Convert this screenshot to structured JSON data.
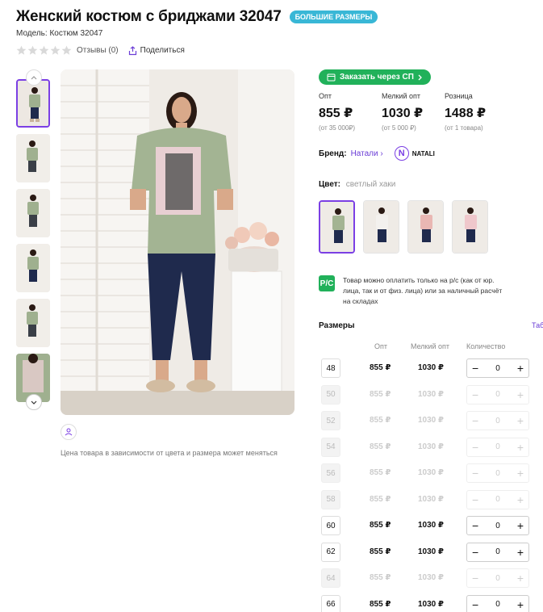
{
  "product": {
    "title": "Женский костюм с бриджами 32047",
    "badge": "БОЛЬШИЕ РАЗМЕРЫ",
    "model": "Модель: Костюм 32047",
    "reviews": "Отзывы (0)",
    "share": "Поделиться",
    "price_note": "Цена товара в зависимости от цвета и размера может меняться"
  },
  "order_sp": "Заказать через СП",
  "prices": [
    {
      "label": "Опт",
      "value": "855 ₽",
      "sub": "(от 35 000₽)"
    },
    {
      "label": "Мелкий опт",
      "value": "1030 ₽",
      "sub": "(от 5 000 ₽)"
    },
    {
      "label": "Розница",
      "value": "1488 ₽",
      "sub": "(от 1 товара)"
    }
  ],
  "brand": {
    "label": "Бренд:",
    "name": "Натали",
    "logo_text": "NATALI"
  },
  "color": {
    "label": "Цвет:",
    "value": "светлый хаки"
  },
  "payment": {
    "icon_text": "Р/С",
    "text": "Товар можно оплатить только на р/с (как от юр. лица, так и от физ. лица) или за наличный расчёт на складах"
  },
  "sizes": {
    "title": "Размеры",
    "table_link": "Таб",
    "headers": {
      "opt": "Опт",
      "small_opt": "Мелкий опт",
      "qty": "Количество"
    },
    "rows": [
      {
        "size": "48",
        "opt": "855 ₽",
        "small": "1030 ₽",
        "qty": "0",
        "available": true
      },
      {
        "size": "50",
        "opt": "855 ₽",
        "small": "1030 ₽",
        "qty": "0",
        "available": false
      },
      {
        "size": "52",
        "opt": "855 ₽",
        "small": "1030 ₽",
        "qty": "0",
        "available": false
      },
      {
        "size": "54",
        "opt": "855 ₽",
        "small": "1030 ₽",
        "qty": "0",
        "available": false
      },
      {
        "size": "56",
        "opt": "855 ₽",
        "small": "1030 ₽",
        "qty": "0",
        "available": false
      },
      {
        "size": "58",
        "opt": "855 ₽",
        "small": "1030 ₽",
        "qty": "0",
        "available": false
      },
      {
        "size": "60",
        "opt": "855 ₽",
        "small": "1030 ₽",
        "qty": "0",
        "available": true
      },
      {
        "size": "62",
        "opt": "855 ₽",
        "small": "1030 ₽",
        "qty": "0",
        "available": true
      },
      {
        "size": "64",
        "opt": "855 ₽",
        "small": "1030 ₽",
        "qty": "0",
        "available": false
      },
      {
        "size": "66",
        "opt": "855 ₽",
        "small": "1030 ₽",
        "qty": "0",
        "available": true
      }
    ]
  },
  "colors": {
    "accent": "#7b3fe4",
    "green": "#21b15a",
    "badge": "#39b7d6"
  }
}
